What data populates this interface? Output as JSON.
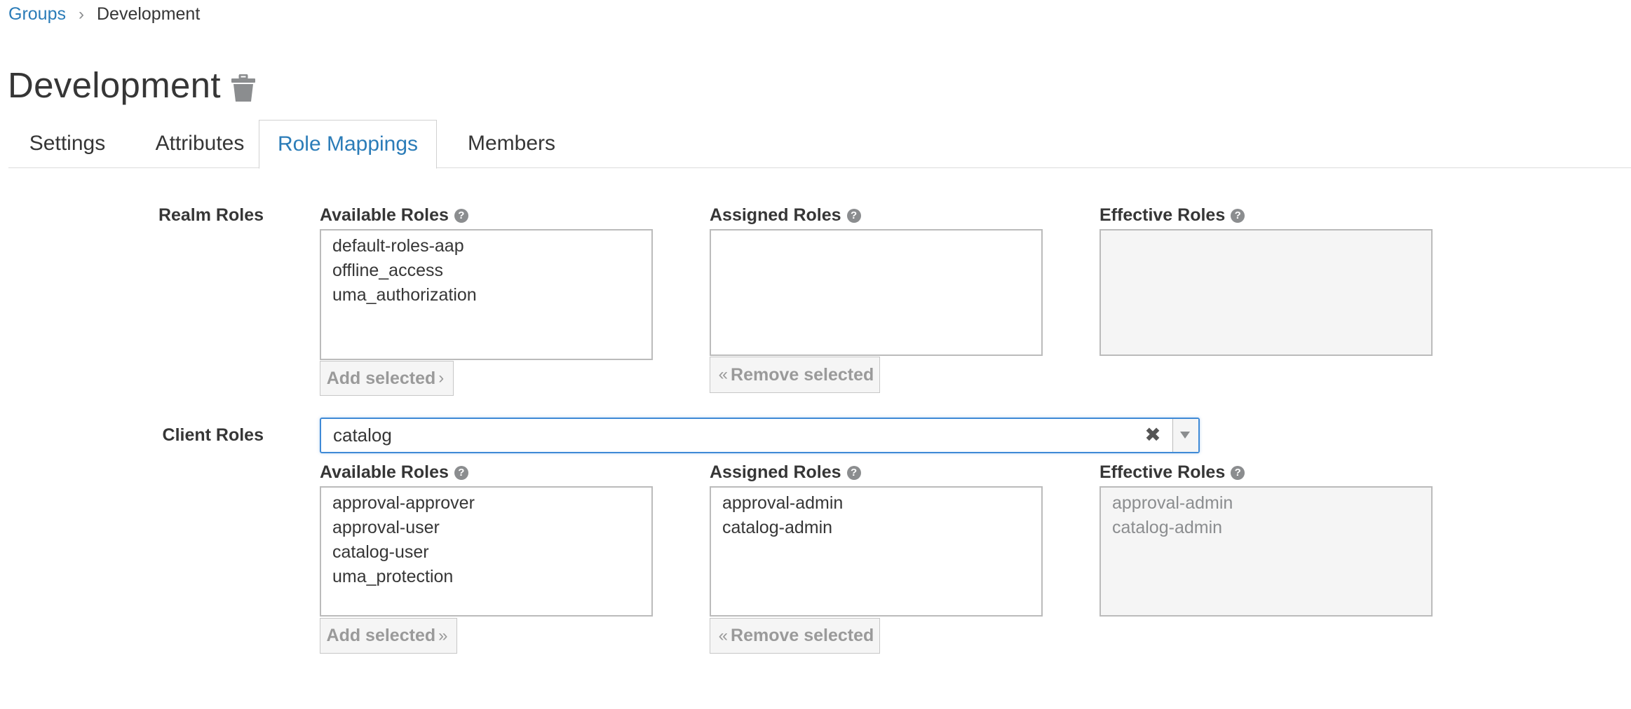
{
  "breadcrumb": {
    "parent": "Groups",
    "separator": "›",
    "current": "Development"
  },
  "page": {
    "title": "Development"
  },
  "tabs": [
    {
      "label": "Settings"
    },
    {
      "label": "Attributes"
    },
    {
      "label": "Role Mappings",
      "active": true
    },
    {
      "label": "Members"
    }
  ],
  "realm": {
    "section_label": "Realm Roles",
    "available_label": "Available Roles",
    "assigned_label": "Assigned Roles",
    "effective_label": "Effective Roles",
    "available": [
      "default-roles-aap",
      "offline_access",
      "uma_authorization"
    ],
    "assigned": [],
    "effective": [],
    "add_label": "Add selected",
    "remove_label": "Remove selected"
  },
  "client": {
    "section_label": "Client Roles",
    "selected_client": "catalog",
    "available_label": "Available Roles",
    "assigned_label": "Assigned Roles",
    "effective_label": "Effective Roles",
    "available": [
      "approval-approver",
      "approval-user",
      "catalog-user",
      "uma_protection"
    ],
    "assigned": [
      "approval-admin",
      "catalog-admin"
    ],
    "effective": [
      "approval-admin",
      "catalog-admin"
    ],
    "add_label": "Add selected",
    "remove_label": "Remove selected"
  },
  "icons": {
    "help": "question-circle-icon",
    "delete": "trash-icon",
    "clear": "close-icon",
    "dropdown": "caret-down-icon"
  },
  "colors": {
    "link": "#2b7cb8",
    "focus_border": "#3f8ad6",
    "text": "#363636",
    "muted": "#8b8d8f"
  }
}
